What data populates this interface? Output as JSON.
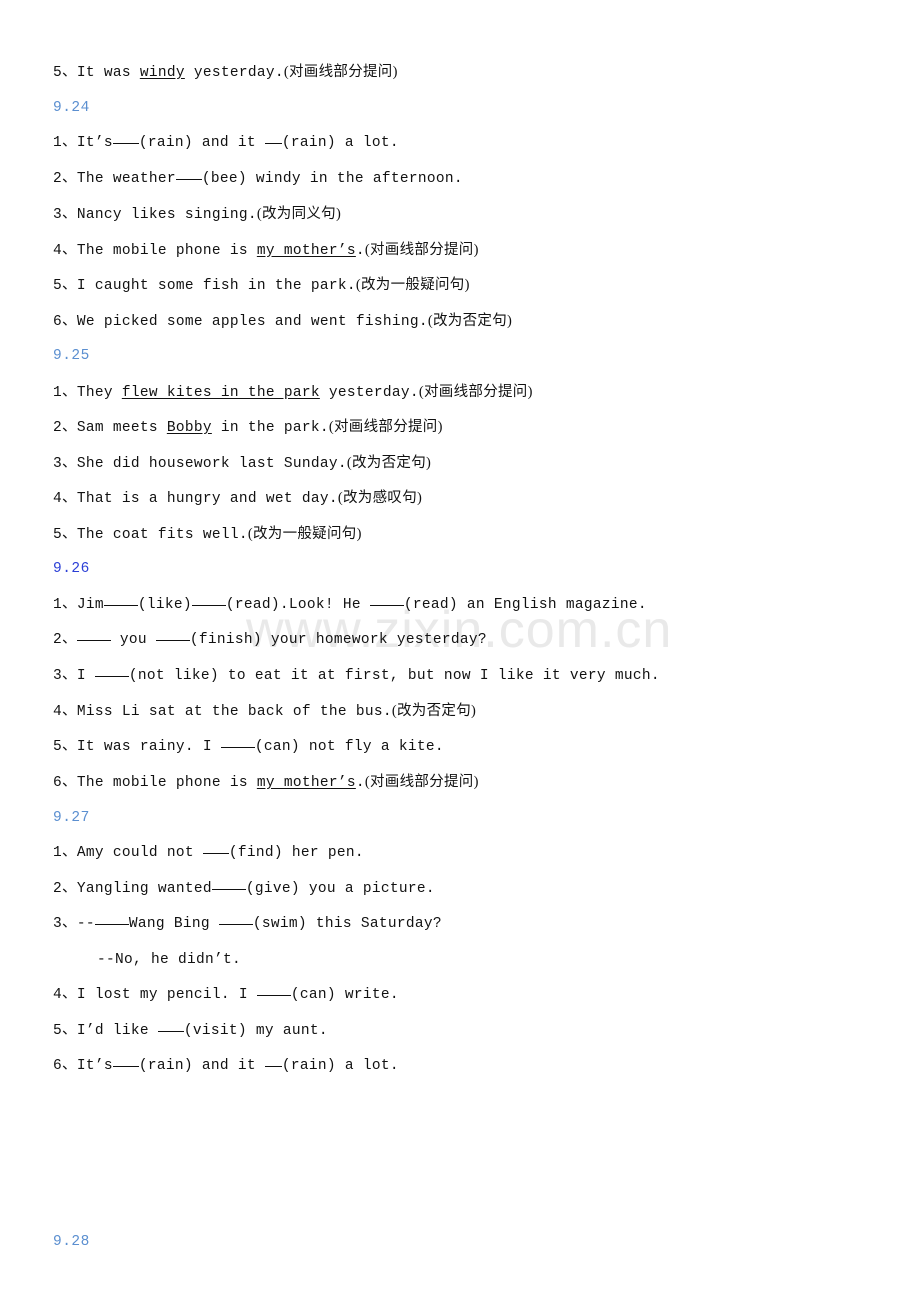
{
  "document": {
    "watermark": "www.zixin.com.cn",
    "heading_color_light": "#5b8fd0",
    "heading_color_dark": "#2b3fd6",
    "text_color": "#111111",
    "background": "#ffffff"
  },
  "top_item": {
    "number": "5、",
    "before": "It was ",
    "underlined": "windy",
    "after": " yesterday.",
    "instruction": "(对画线部分提问)"
  },
  "sections": [
    {
      "date": "9.24",
      "items": [
        {
          "number": "1、",
          "p1": "It’s",
          "blank1": "b3",
          "p2": "(rain) and it ",
          "blank2": "b2",
          "p3": "(rain) a lot.",
          "instruction": ""
        },
        {
          "number": "2、",
          "p1": "The weather",
          "blank1": "b3",
          "p2": "(bee) windy in the afternoon.",
          "instruction": ""
        },
        {
          "number": "3、",
          "p1": "Nancy likes singing.",
          "instruction": "(改为同义句)"
        },
        {
          "number": "4、",
          "p1": "The mobile phone is ",
          "underlined": "my mother’s",
          "p2": ".",
          "instruction": "(对画线部分提问)"
        },
        {
          "number": "5、",
          "p1": "I caught some fish in the park.",
          "instruction": "(改为一般疑问句)"
        },
        {
          "number": "6、",
          "p1": "We picked some apples and went fishing.",
          "instruction": "(改为否定句)"
        }
      ]
    },
    {
      "date": "9.25",
      "items": [
        {
          "number": "1、",
          "p1": "They ",
          "underlined": "flew kites in the park",
          "p2": " yesterday.",
          "instruction": "(对画线部分提问)"
        },
        {
          "number": "2、",
          "p1": "Sam meets ",
          "underlined": "Bobby",
          "p2": " in the park.",
          "instruction": "(对画线部分提问)"
        },
        {
          "number": "3、",
          "p1": "She did housework last Sunday.",
          "instruction": "(改为否定句)"
        },
        {
          "number": "4、",
          "p1": "That is a hungry and wet day.",
          "instruction": "(改为感叹句)"
        },
        {
          "number": "5、",
          "p1": "The coat fits well.",
          "instruction": "(改为一般疑问句)"
        }
      ]
    },
    {
      "date": "9.26",
      "dark": true,
      "items": [
        {
          "number": "1、",
          "p1": "Jim",
          "blank1": "b4",
          "p2": "(like)",
          "blank2": "b4",
          "p3": "(read).Look! He ",
          "blank3": "b4",
          "p4": "(read) an English magazine."
        },
        {
          "number": "2、",
          "p1": "",
          "blank1": "b4",
          "p2": " you ",
          "blank2": "b4",
          "p3": "(finish) your homework yesterday?"
        },
        {
          "number": "3、",
          "p1": "I ",
          "blank1": "b4",
          "p2": "(not like) to eat it at first, but now I like it very much."
        },
        {
          "number": "4、",
          "p1": "Miss Li sat at the back of the bus.",
          "instruction": "(改为否定句)"
        },
        {
          "number": "5、",
          "p1": "It was rainy. I ",
          "blank1": "b4",
          "p2": "(can) not fly a kite."
        },
        {
          "number": "6、",
          "p1": "The mobile phone is ",
          "underlined": "my mother’s",
          "p2": ".",
          "instruction": "(对画线部分提问)"
        }
      ]
    },
    {
      "date": "9.27",
      "items": [
        {
          "number": "1、",
          "p1": "Amy could not ",
          "blank1": "b3",
          "p2": "(find) her pen."
        },
        {
          "number": "2、",
          "p1": "Yangling wanted",
          "blank1": "b4",
          "p2": "(give) you a picture."
        },
        {
          "number": "3、",
          "p1": "--",
          "blank1": "b4",
          "p2": "Wang Bing ",
          "blank2": "b4",
          "p3": "(swim) this Saturday?"
        },
        {
          "number": "",
          "indent": true,
          "p1": "--No, he didn’t."
        },
        {
          "number": "4、",
          "p1": "I lost my pencil. I ",
          "blank1": "b4",
          "p2": "(can) write."
        },
        {
          "number": "5、",
          "p1": "I’d like ",
          "blank1": "b3",
          "p2": "(visit) my aunt."
        },
        {
          "number": "6、",
          "p1": "It’s",
          "blank1": "b3",
          "p2": "(rain) and it ",
          "blank2": "b2",
          "p3": "(rain) a lot."
        }
      ]
    },
    {
      "date": "9.28",
      "items": []
    }
  ]
}
